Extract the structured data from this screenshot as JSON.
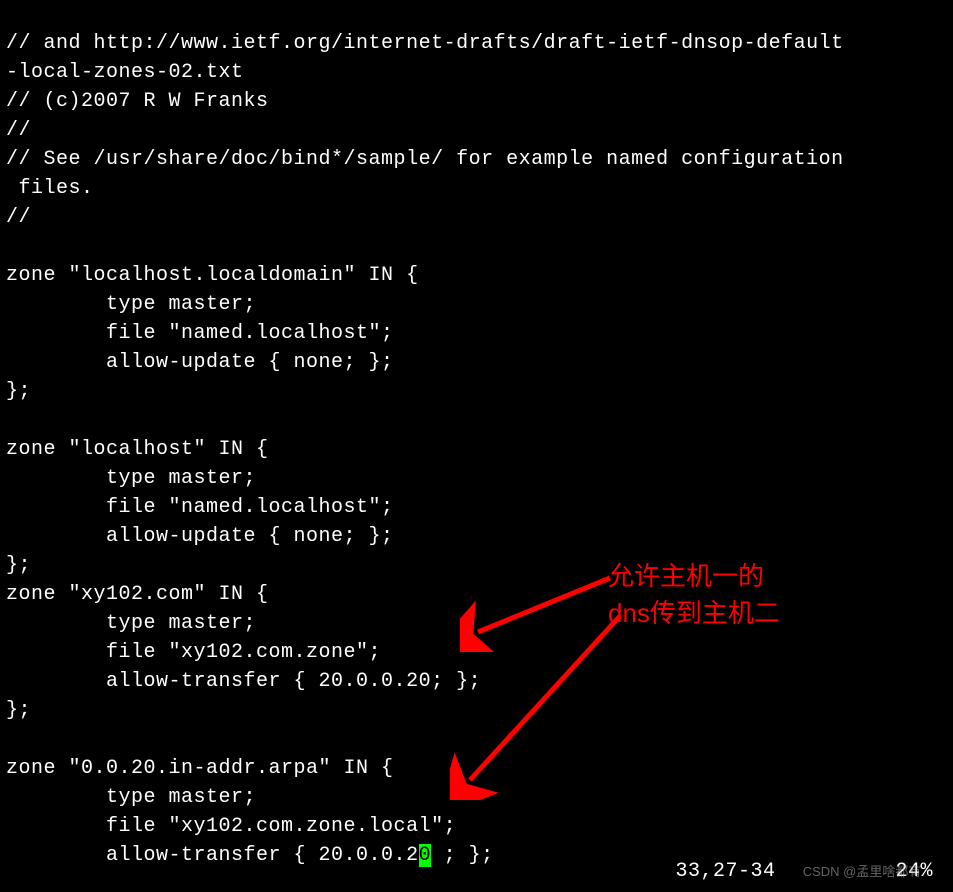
{
  "lines": [
    "// and http://www.ietf.org/internet-drafts/draft-ietf-dnsop-default",
    "-local-zones-02.txt",
    "// (c)2007 R W Franks",
    "//",
    "// See /usr/share/doc/bind*/sample/ for example named configuration",
    " files.",
    "//",
    "",
    "zone \"localhost.localdomain\" IN {",
    "        type master;",
    "        file \"named.localhost\";",
    "        allow-update { none; };",
    "};",
    "",
    "zone \"localhost\" IN {",
    "        type master;",
    "        file \"named.localhost\";",
    "        allow-update { none; };",
    "};",
    "zone \"xy102.com\" IN {",
    "        type master;",
    "        file \"xy102.com.zone\";",
    "        allow-transfer { 20.0.0.20; };",
    "};",
    "",
    "zone \"0.0.20.in-addr.arpa\" IN {",
    "        type master;",
    "        file \"xy102.com.zone.local\";"
  ],
  "cursor_line": {
    "prefix": "        allow-transfer { 20.0.0.2",
    "cursor_char": "0",
    "suffix": " ; };"
  },
  "annotation": {
    "line1": "允许主机一的",
    "line2": "dns传到主机二"
  },
  "status": {
    "position": "33,27-34",
    "percent": "24%"
  },
  "watermark": "CSDN @孟里啥都有."
}
